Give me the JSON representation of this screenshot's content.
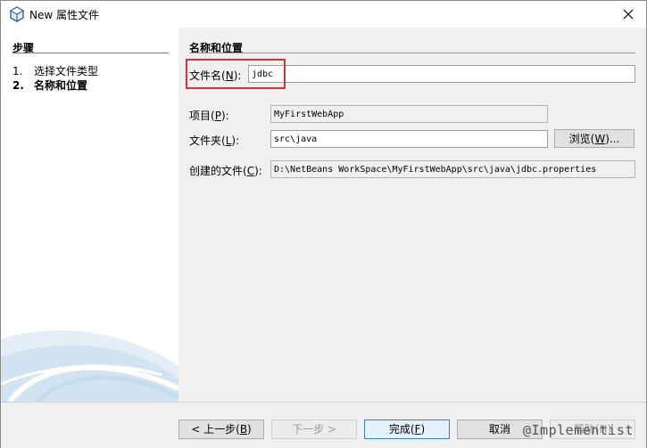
{
  "window": {
    "title": "New 属性文件",
    "close_icon": "close-icon"
  },
  "steps": {
    "header": "步骤",
    "items": [
      {
        "num": "1.",
        "label": "选择文件类型"
      },
      {
        "num": "2.",
        "label": "名称和位置"
      }
    ]
  },
  "form": {
    "section_title": "名称和位置",
    "file_name_label": "文件名",
    "file_name_mnemonic": "N",
    "file_name_value": "jdbc",
    "project_label": "项目",
    "project_mnemonic": "P",
    "project_value": "MyFirstWebApp",
    "folder_label": "文件夹",
    "folder_mnemonic": "L",
    "folder_value": "src\\java",
    "browse_label": "浏览(",
    "browse_mnemonic": "W",
    "browse_suffix": ")...",
    "created_label": "创建的文件",
    "created_mnemonic": "C",
    "created_value": "D:\\NetBeans WorkSpace\\MyFirstWebApp\\src\\java\\jdbc.properties"
  },
  "buttons": {
    "back_prefix": "< 上一步(",
    "back_mnemonic": "B",
    "back_suffix": ")",
    "next": "下一步 >",
    "finish_prefix": "完成(",
    "finish_mnemonic": "F",
    "finish_suffix": ")",
    "cancel": "取消",
    "help": "帮助(H)"
  },
  "watermark": "@Implementist"
}
